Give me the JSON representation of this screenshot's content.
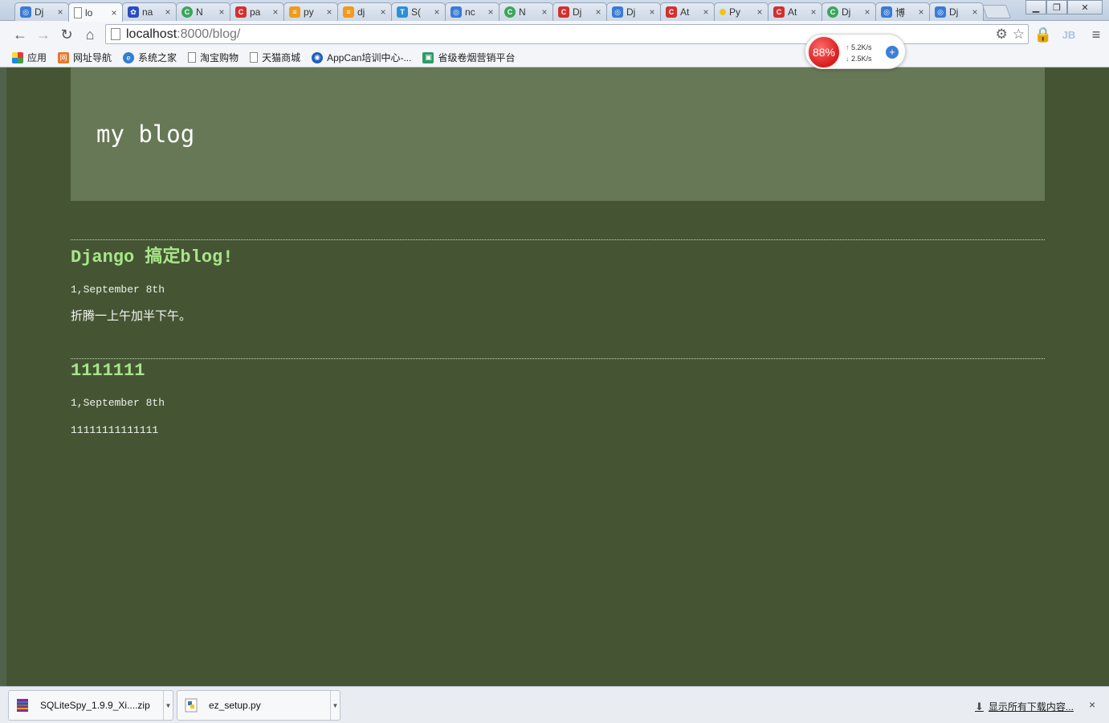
{
  "browser": {
    "tabs": [
      {
        "title": "Dj",
        "icon_color": "#3a7bd5",
        "active": false
      },
      {
        "title": "lo",
        "icon_color": "#ffffff",
        "active": true
      },
      {
        "title": "na",
        "icon_color": "#2a4dbd",
        "active": false
      },
      {
        "title": "N",
        "icon_color": "#3aa55a",
        "active": false
      },
      {
        "title": "pa",
        "icon_color": "#d32f2f",
        "active": false
      },
      {
        "title": "py",
        "icon_color": "#f29a1a",
        "active": false
      },
      {
        "title": "dj",
        "icon_color": "#f29a1a",
        "active": false
      },
      {
        "title": "S(",
        "icon_color": "#2b8fd6",
        "active": false
      },
      {
        "title": "nc",
        "icon_color": "#3a7bd5",
        "active": false
      },
      {
        "title": "N",
        "icon_color": "#3aa55a",
        "active": false
      },
      {
        "title": "Dj",
        "icon_color": "#d32f2f",
        "active": false
      },
      {
        "title": "Dj",
        "icon_color": "#3a7bd5",
        "active": false
      },
      {
        "title": "At",
        "icon_color": "#d32f2f",
        "active": false
      },
      {
        "title": "Py",
        "icon_color": "#f0c419",
        "active": false
      },
      {
        "title": "At",
        "icon_color": "#d32f2f",
        "active": false
      },
      {
        "title": "Dj",
        "icon_color": "#3aa55a",
        "active": false
      },
      {
        "title": "博",
        "icon_color": "#3a7bd5",
        "active": false
      },
      {
        "title": "Dj",
        "icon_color": "#3a7bd5",
        "active": false
      }
    ],
    "tab_close_glyph": "×",
    "address": {
      "host": "localhost",
      "path": ":8000/blog/"
    },
    "bookmarks": [
      {
        "label": "应用",
        "icon": "apps-grid-icon"
      },
      {
        "label": "网址导航",
        "icon": "nav-site-icon"
      },
      {
        "label": "系统之家",
        "icon": "globe-icon"
      },
      {
        "label": "淘宝购物",
        "icon": "page-icon"
      },
      {
        "label": "天猫商城",
        "icon": "page-icon"
      },
      {
        "label": "AppCan培训中心-...",
        "icon": "appcan-icon"
      },
      {
        "label": "省级卷烟营销平台",
        "icon": "platform-icon"
      }
    ]
  },
  "speed_widget": {
    "percent": "88%",
    "upload": "5.2K/s",
    "download": "2.5K/s",
    "plus": "+"
  },
  "blog": {
    "title": "my blog",
    "posts": [
      {
        "title": "Django 搞定blog!",
        "date": "1,September 8th",
        "body": "折腾一上午加半下午。"
      },
      {
        "title": "1111111",
        "date": "1,September 8th",
        "body": "11111111111111"
      }
    ]
  },
  "downloads": {
    "items": [
      {
        "name": "SQLiteSpy_1.9.9_Xi....zip",
        "icon": "winrar-icon"
      },
      {
        "name": "ez_setup.py",
        "icon": "python-file-icon"
      }
    ],
    "show_all": "显示所有下载内容...",
    "close": "×"
  },
  "colors": {
    "page_bg": "#455534",
    "header_bg": "#677856",
    "post_title": "#a8e68a"
  }
}
